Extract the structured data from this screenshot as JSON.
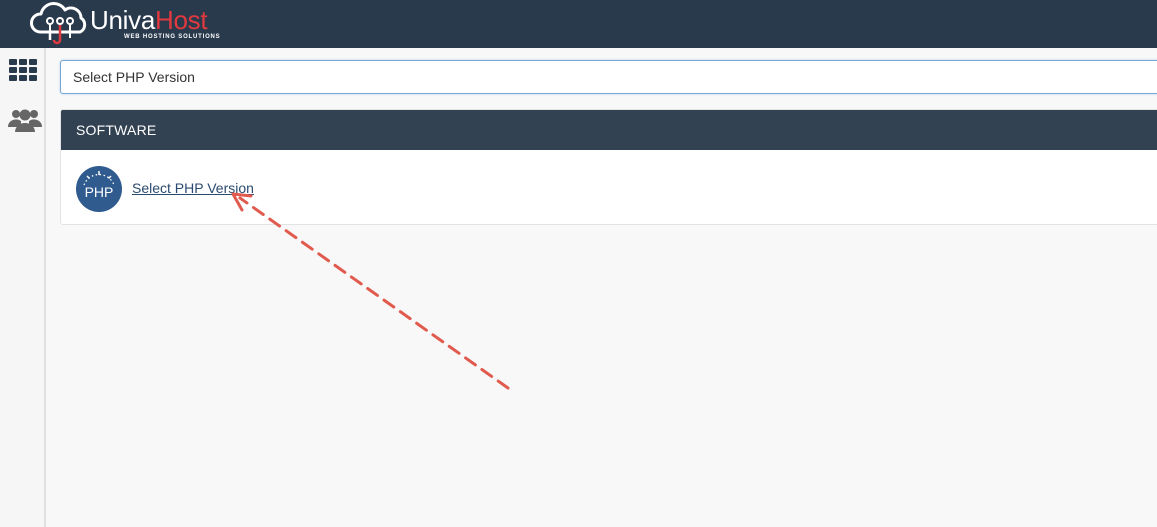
{
  "brand": {
    "name_primary": "Univa",
    "name_accent": "Host",
    "tagline": "WEB HOSTING SOLUTIONS",
    "accent_color": "#e0393e"
  },
  "sidebar": {
    "items": [
      {
        "icon": "grid-icon"
      },
      {
        "icon": "users-icon"
      }
    ]
  },
  "search": {
    "value": "Select PHP Version"
  },
  "panel": {
    "title": "SOFTWARE",
    "items": [
      {
        "label": "Select PHP Version",
        "icon": "php-icon",
        "icon_text": "PHP"
      }
    ]
  },
  "annotation": {
    "type": "dashed-arrow",
    "color": "#e05a4e"
  },
  "colors": {
    "topbar": "#2a3a4d",
    "panel_header": "#334252",
    "link": "#2b4a6f"
  }
}
